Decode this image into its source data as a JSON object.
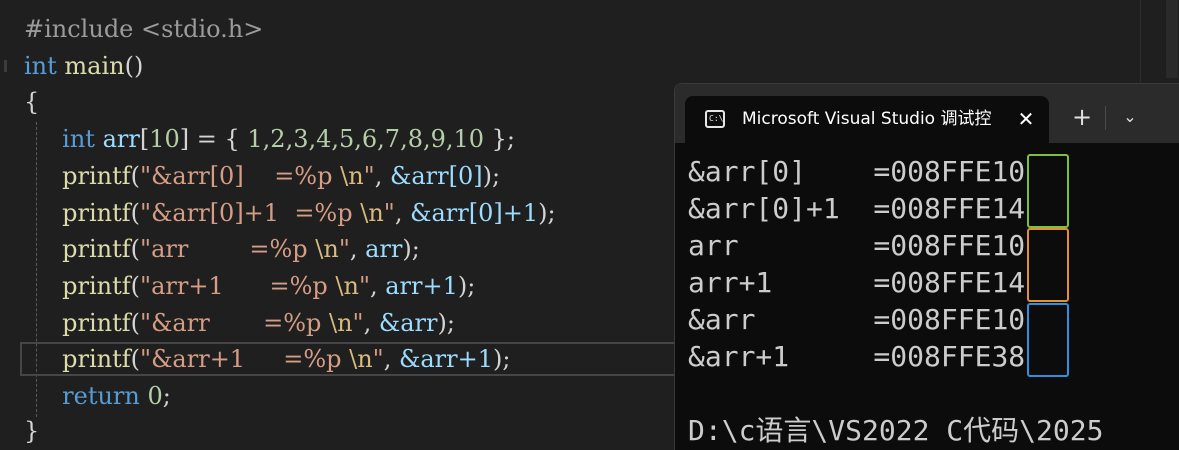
{
  "editor": {
    "lines": [
      {
        "a": "#include <stdio.h>"
      },
      {
        "kw": "int",
        "fn": "main",
        "p": "()"
      },
      {
        "p": "{"
      },
      {
        "kw": "int",
        "var": "arr",
        "n10": "10",
        "vals": "1,2,3,4,5,6,7,8,9,10"
      },
      {
        "fn": "printf",
        "s1": "\"&arr[0]    =%p ",
        "esc": "\\n",
        "s2": "\"",
        "arg": "&arr[0]",
        "end": ");"
      },
      {
        "fn": "printf",
        "s1": "\"&arr[0]+1  =%p ",
        "esc": "\\n",
        "s2": "\"",
        "arg": "&arr[0]+1",
        "end": ");"
      },
      {
        "fn": "printf",
        "s1": "\"arr        =%p ",
        "esc": "\\n",
        "s2": "\"",
        "arg": "arr",
        "end": ");"
      },
      {
        "fn": "printf",
        "s1": "\"arr+1      =%p ",
        "esc": "\\n",
        "s2": "\"",
        "arg": "arr+1",
        "end": ");"
      },
      {
        "fn": "printf",
        "s1": "\"&arr       =%p ",
        "esc": "\\n",
        "s2": "\"",
        "arg": "&arr",
        "end": ");"
      },
      {
        "fn": "printf",
        "s1": "\"&arr+1     =%p ",
        "esc": "\\n",
        "s2": "\"",
        "arg": "&arr+1",
        "end": ");"
      },
      {
        "kw": "return",
        "n": "0",
        "p": ";"
      },
      {
        "p": "}"
      }
    ]
  },
  "terminal": {
    "tab_icon": "C:\\",
    "tab_title": "Microsoft Visual Studio 调试控制台",
    "close_glyph": "✕",
    "new_tab_glyph": "+",
    "dropdown_glyph": "⌄",
    "output": [
      {
        "label": "&arr[0]    =008FFE",
        "suffix": "10"
      },
      {
        "label": "&arr[0]+1  =008FFE",
        "suffix": "14"
      },
      {
        "label": "arr        =008FFE",
        "suffix": "10"
      },
      {
        "label": "arr+1      =008FFE",
        "suffix": "14"
      },
      {
        "label": "&arr       =008FFE",
        "suffix": "10"
      },
      {
        "label": "&arr+1     =008FFE",
        "suffix": "38"
      }
    ],
    "path_line": "D:\\c语言\\VS2022 C代码\\2025"
  },
  "colors": {
    "highlight_green": "#7fbf3f",
    "highlight_orange": "#e0922f",
    "highlight_blue": "#2f8fe0"
  }
}
